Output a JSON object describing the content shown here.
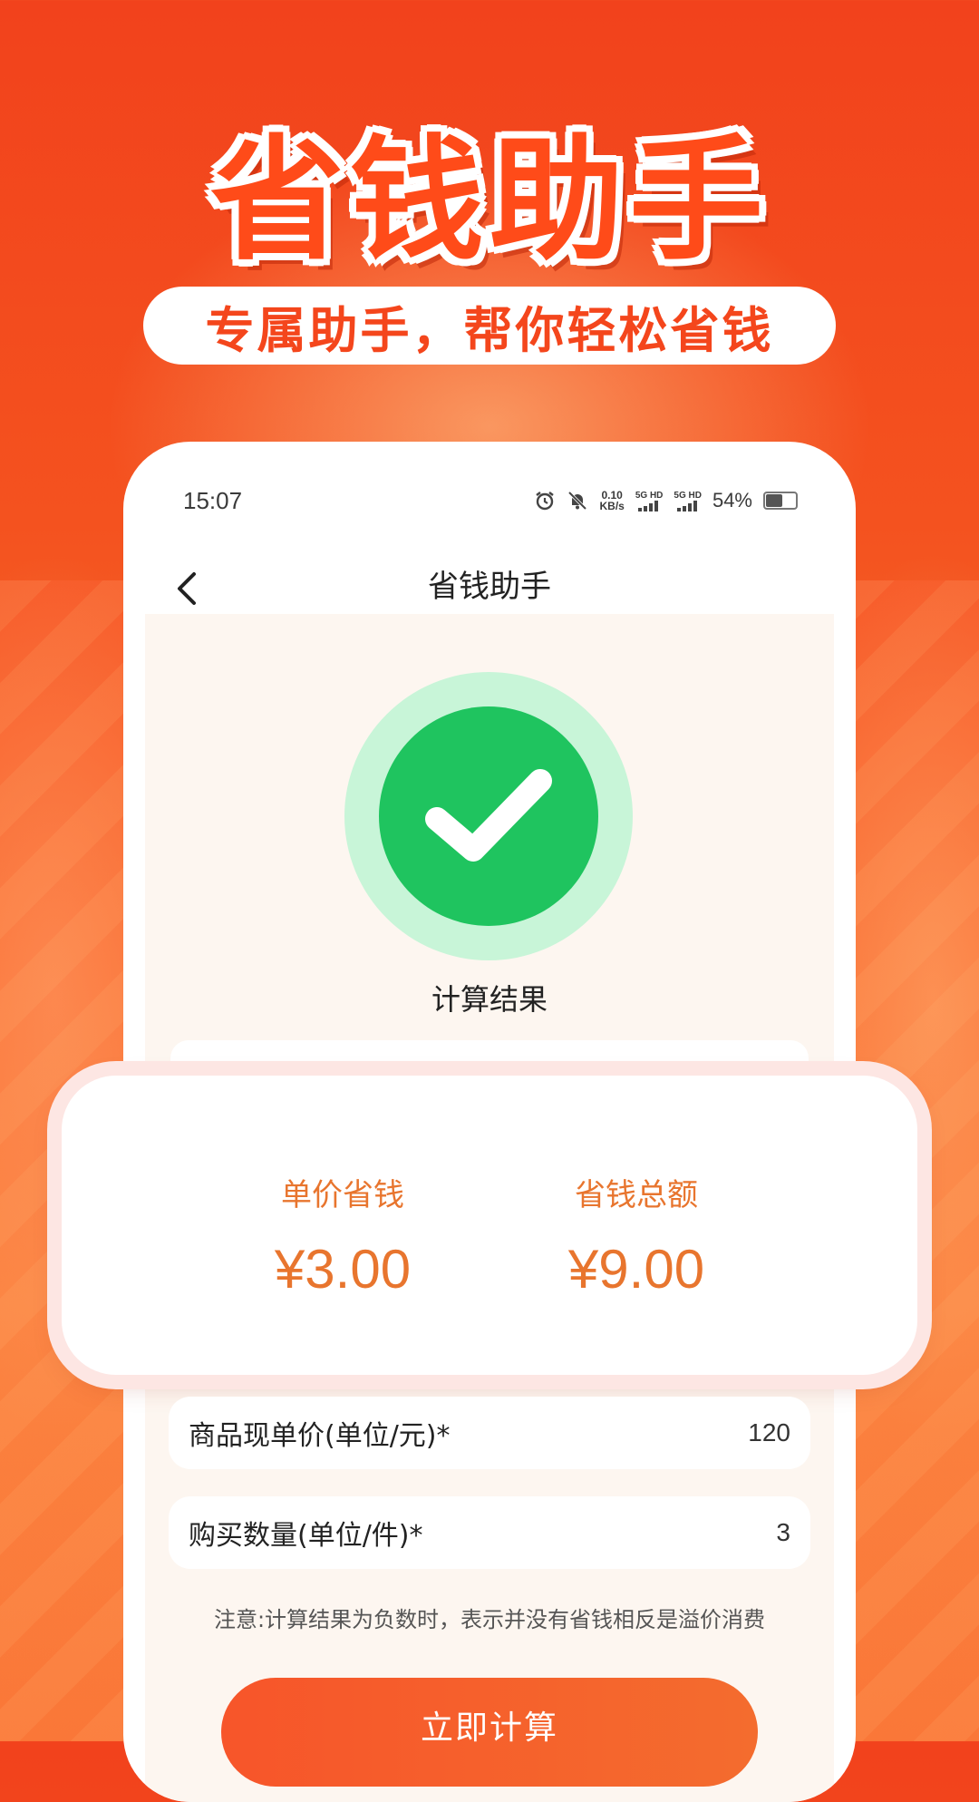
{
  "headline": "省钱助手",
  "tagline": "专属助手，帮你轻松省钱",
  "status_bar": {
    "time": "15:07",
    "net_speed_value": "0.10",
    "net_speed_unit": "KB/s",
    "sim1": "5G HD",
    "sim2": "5G HD",
    "battery": "54%"
  },
  "nav": {
    "title": "省钱助手"
  },
  "result": {
    "label": "计算结果",
    "unit_saving_label": "单价省钱",
    "unit_saving_value": "¥3.00",
    "total_saving_label": "省钱总额",
    "total_saving_value": "¥9.00"
  },
  "form": {
    "price_label": "商品现单价(单位/元)*",
    "price_value": "120",
    "quantity_label": "购买数量(单位/件)*",
    "quantity_value": "3"
  },
  "note": "注意:计算结果为负数时，表示并没有省钱相反是溢价消费",
  "button": {
    "calculate_label": "立即计算"
  },
  "colors": {
    "accent": "#f4461c",
    "result_text": "#e8752e",
    "success_green": "#1fc45f"
  }
}
